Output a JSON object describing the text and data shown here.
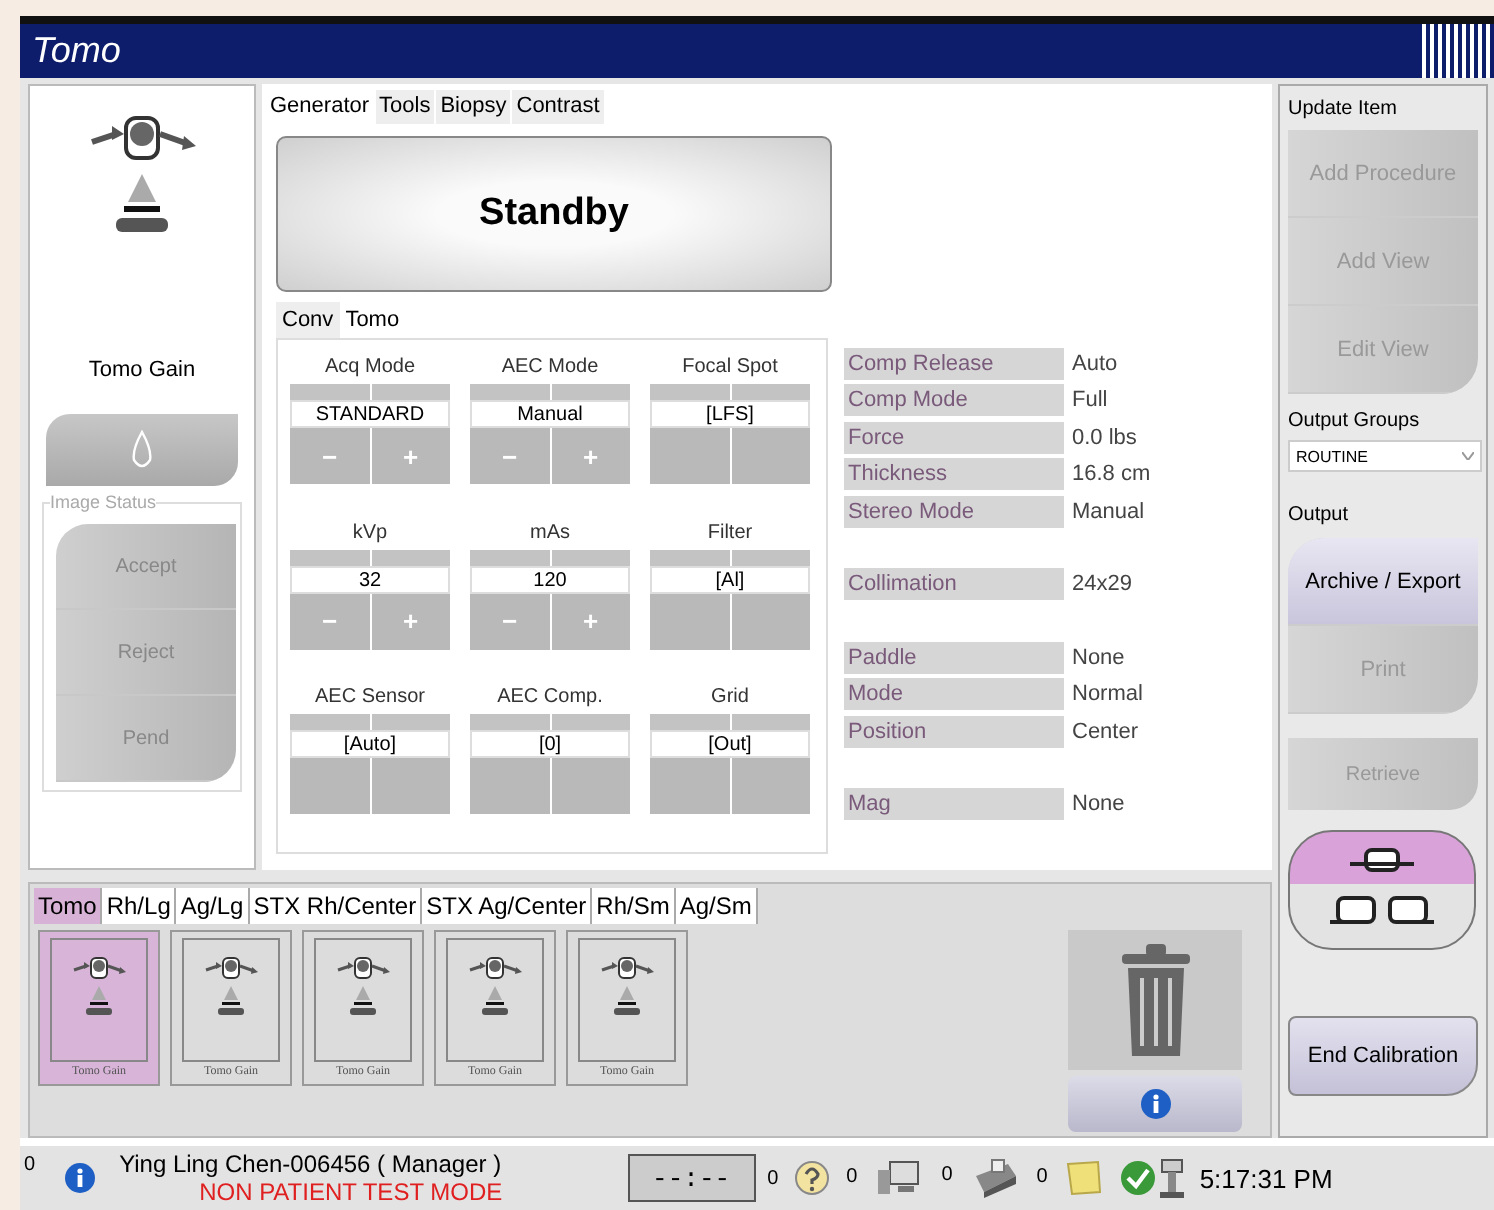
{
  "window": {
    "title": "Tomo"
  },
  "left_panel": {
    "gain_label": "Tomo Gain",
    "image_status": {
      "title": "Image Status",
      "buttons": [
        {
          "label": "Accept",
          "disabled": true
        },
        {
          "label": "Reject",
          "disabled": true
        },
        {
          "label": "Pend",
          "disabled": true
        }
      ]
    }
  },
  "tabs": [
    {
      "label": "Generator",
      "selected": true
    },
    {
      "label": "Tools",
      "selected": false
    },
    {
      "label": "Biopsy",
      "selected": false
    },
    {
      "label": "Contrast",
      "selected": false
    }
  ],
  "status_display": "Standby",
  "sub_tabs": [
    {
      "label": "Conv",
      "selected": false
    },
    {
      "label": "Tomo",
      "selected": true
    }
  ],
  "params": [
    {
      "label": "Acq Mode",
      "value": "STANDARD",
      "kind": "stepper",
      "minus": "−",
      "plus": "+"
    },
    {
      "label": "AEC Mode",
      "value": "Manual",
      "kind": "stepper",
      "minus": "−",
      "plus": "+"
    },
    {
      "label": "Focal Spot",
      "value": "[LFS]",
      "kind": "blank"
    },
    {
      "label": "kVp",
      "value": "32",
      "kind": "stepper",
      "minus": "−",
      "plus": "+"
    },
    {
      "label": "mAs",
      "value": "120",
      "kind": "stepper",
      "minus": "−",
      "plus": "+"
    },
    {
      "label": "Filter",
      "value": "[Al]",
      "kind": "blank"
    },
    {
      "label": "AEC Sensor",
      "value": "[Auto]",
      "kind": "blank"
    },
    {
      "label": "AEC Comp.",
      "value": "[0]",
      "kind": "blank"
    },
    {
      "label": "Grid",
      "value": "[Out]",
      "kind": "blank"
    }
  ],
  "info_groups": [
    {
      "rows": [
        {
          "label": "Comp Release",
          "value": "Auto"
        },
        {
          "label": "Comp Mode",
          "value": "Full"
        },
        {
          "label": "Force",
          "value": "0.0 lbs"
        },
        {
          "label": "Thickness",
          "value": "16.8 cm"
        },
        {
          "label": "Stereo Mode",
          "value": "Manual"
        }
      ]
    },
    {
      "rows": [
        {
          "label": "Collimation",
          "value": "24x29"
        }
      ]
    },
    {
      "rows": [
        {
          "label": "Paddle",
          "value": "None"
        },
        {
          "label": "Mode",
          "value": "Normal"
        },
        {
          "label": "Position",
          "value": "Center"
        }
      ]
    },
    {
      "rows": [
        {
          "label": "Mag",
          "value": "None"
        }
      ]
    }
  ],
  "view_tabs": [
    {
      "label": "Tomo",
      "selected": true
    },
    {
      "label": "Rh/Lg",
      "selected": false
    },
    {
      "label": "Ag/Lg",
      "selected": false
    },
    {
      "label": "STX Rh/Center",
      "selected": false
    },
    {
      "label": "STX Ag/Center",
      "selected": false
    },
    {
      "label": "Rh/Sm",
      "selected": false
    },
    {
      "label": "Ag/Sm",
      "selected": false
    }
  ],
  "thumbnails": [
    {
      "label": "Tomo Gain",
      "selected": true
    },
    {
      "label": "Tomo Gain",
      "selected": false
    },
    {
      "label": "Tomo Gain",
      "selected": false
    },
    {
      "label": "Tomo Gain",
      "selected": false
    },
    {
      "label": "Tomo Gain",
      "selected": false
    }
  ],
  "right_panel": {
    "update_item": {
      "title": "Update Item",
      "buttons": [
        {
          "label": "Add Procedure",
          "disabled": true
        },
        {
          "label": "Add View",
          "disabled": true
        },
        {
          "label": "Edit View",
          "disabled": true
        }
      ]
    },
    "output_groups": {
      "label": "Output Groups",
      "value": "ROUTINE"
    },
    "output": {
      "title": "Output",
      "buttons": [
        {
          "label": "Archive / Export",
          "disabled": false
        },
        {
          "label": "Print",
          "disabled": true
        }
      ]
    },
    "retrieve": {
      "label": "Retrieve",
      "disabled": true
    },
    "end_calibration": "End Calibration"
  },
  "status_bar": {
    "info_count": "0",
    "user": "Ying Ling Chen-006456 ( Manager )",
    "mode": "NON PATIENT TEST MODE",
    "timer": "--:--",
    "counters": [
      {
        "count": "0",
        "kind": "help"
      },
      {
        "count": "0",
        "kind": "monitor"
      },
      {
        "count": "0",
        "kind": "printer"
      },
      {
        "count": "0",
        "kind": "note"
      }
    ],
    "time": "5:17:31 PM"
  }
}
